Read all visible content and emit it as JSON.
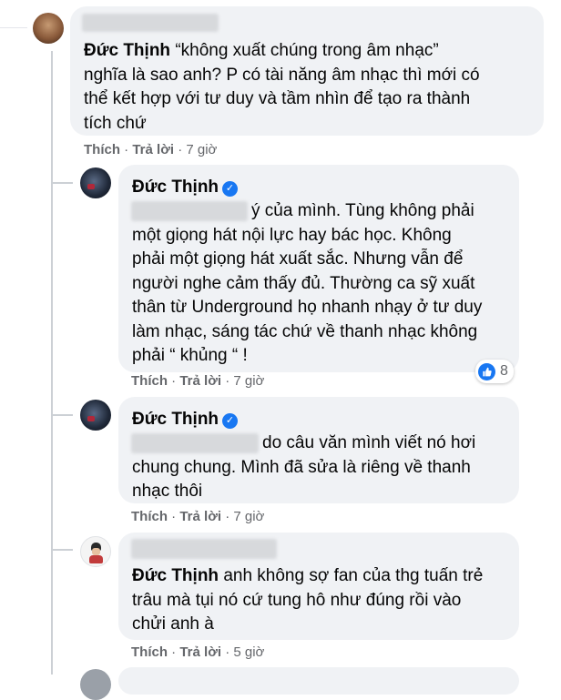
{
  "comments": [
    {
      "author": "Đức Thịnh",
      "text": "“không xuất chúng trong âm nhạc” nghĩa là sao anh? P có tài năng âm nhạc thì mới có thể kết hợp với tư duy và tầm nhìn để tạo ra thành tích chứ",
      "line1_rest": "“không xuất chúng trong âm nhạc”",
      "line2": "nghĩa là sao anh? P có tài năng âm nhạc thì mới có",
      "line3": "thể kết hợp với tư duy và tầm nhìn để tạo ra thành",
      "line4": "tích chứ",
      "like": "Thích",
      "reply": "Trả lời",
      "time": "7 giờ"
    }
  ],
  "replies": [
    {
      "author": "Đức Thịnh",
      "verified": true,
      "lines": [
        "ý của mình. Tùng không phải",
        "một giọng hát nội lực hay bác học. Không",
        "phải một giọng hát xuất sắc. Nhưng vẫn để",
        "người nghe cảm thấy đủ. Thường ca sỹ xuất",
        "thân từ Underground họ nhanh nhạy ở tư duy",
        "làm nhạc, sáng tác chứ về thanh nhạc không",
        "phải “ khủng “ !"
      ],
      "like": "Thích",
      "reply": "Trả lời",
      "time": "7 giờ",
      "reaction_count": "8"
    },
    {
      "author": "Đức Thịnh",
      "verified": true,
      "lines": [
        "do câu văn mình viết nó hơi",
        "chung chung. Mình đã sửa là riêng về thanh",
        "nhạc thôi"
      ],
      "like": "Thích",
      "reply": "Trả lời",
      "time": "7 giờ"
    },
    {
      "mention": "Đức Thịnh",
      "lines": [
        "anh không sợ fan của thg tuấn trẻ",
        "trâu mà tụi nó cứ tung hô như đúng rồi vào",
        "chửi anh à"
      ],
      "like": "Thích",
      "reply": "Trả lời",
      "time": "5 giờ"
    }
  ],
  "separator": " · ",
  "verified_glyph": "✓"
}
